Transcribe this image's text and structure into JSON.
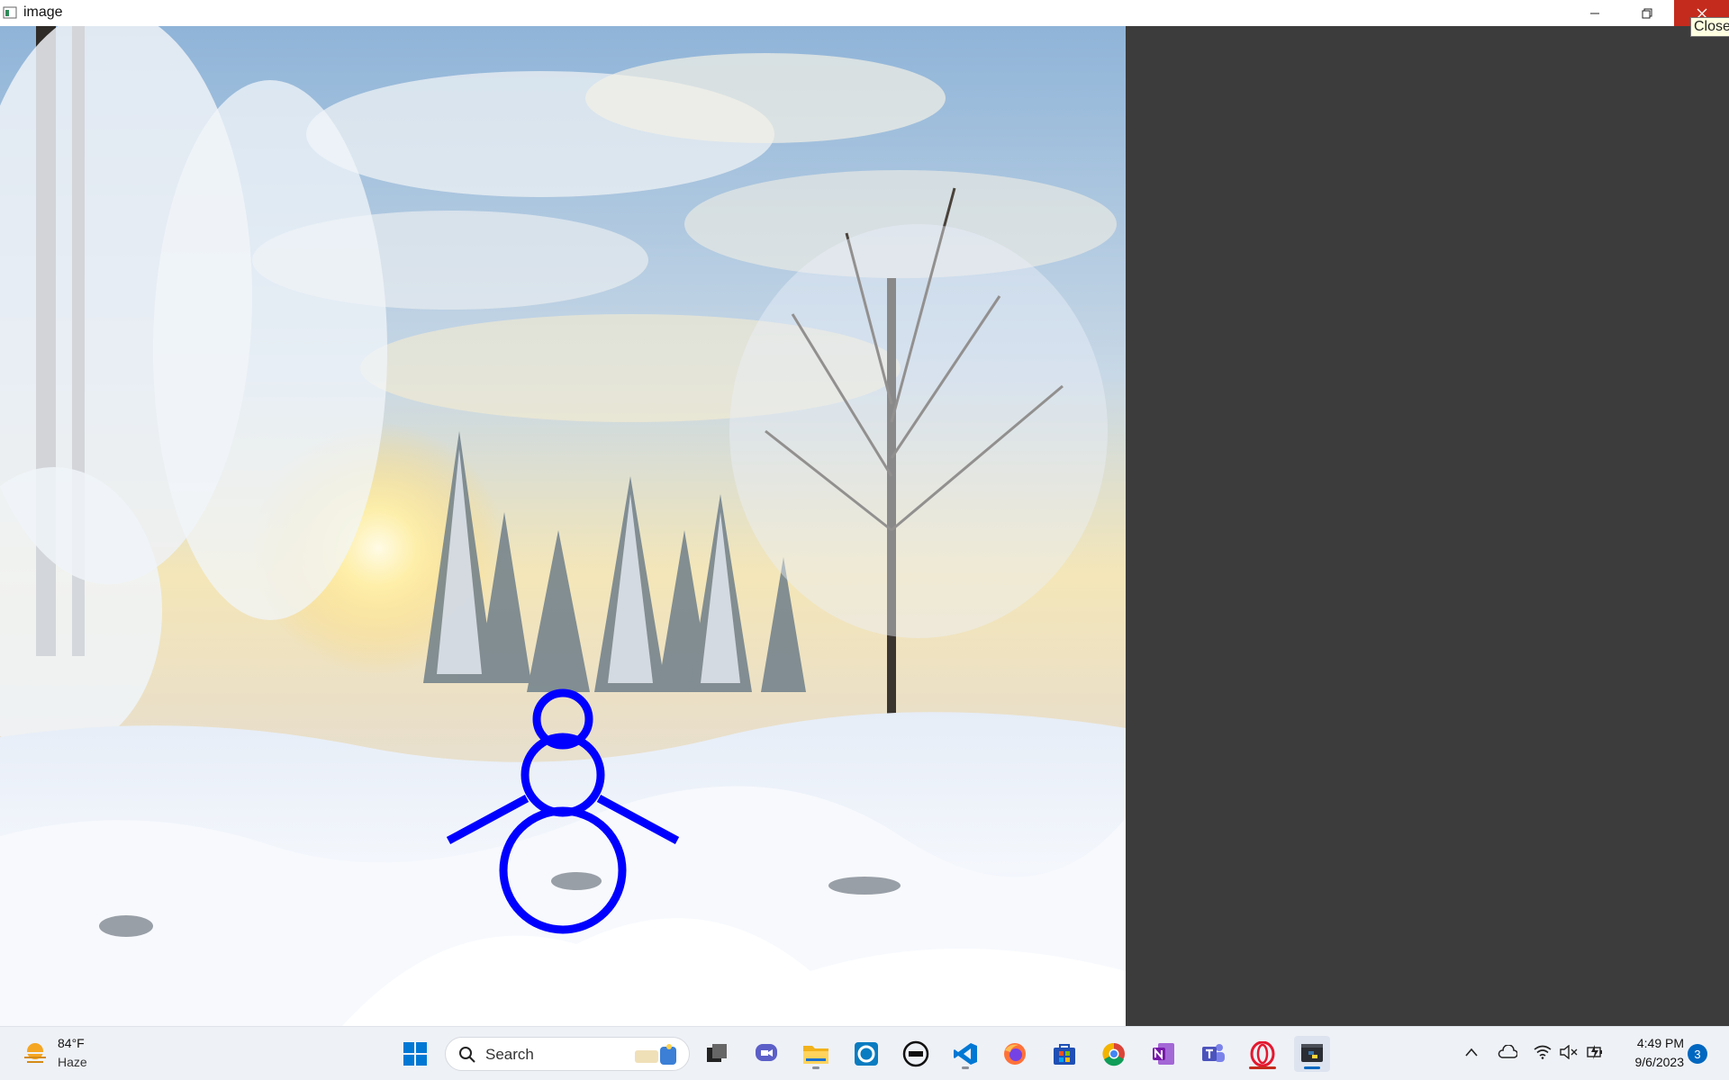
{
  "window": {
    "title": "image",
    "tooltip": "Close",
    "icons": {
      "minimize": "minimize-icon",
      "maximize": "restore-icon",
      "close": "close-icon"
    }
  },
  "image": {
    "description_icon": "winter-forest-photo",
    "overlay_color": "#0000ff"
  },
  "taskbar": {
    "weather": {
      "temperature": "84°F",
      "condition": "Haze"
    },
    "search": {
      "label": "Search"
    },
    "apps": [
      "start-icon",
      "task-view-icon",
      "chat-icon",
      "file-explorer-icon",
      "cortana-icon",
      "dell-icon",
      "vscode-icon",
      "firefox-icon",
      "store-icon",
      "chrome-icon",
      "onenote-icon",
      "teams-icon",
      "opera-icon",
      "python-icon"
    ],
    "tray": {
      "time": "4:49 PM",
      "date": "9/6/2023",
      "notifications": "3"
    },
    "colors": {
      "accent": "#0067c0",
      "close": "#c42b1c"
    }
  }
}
